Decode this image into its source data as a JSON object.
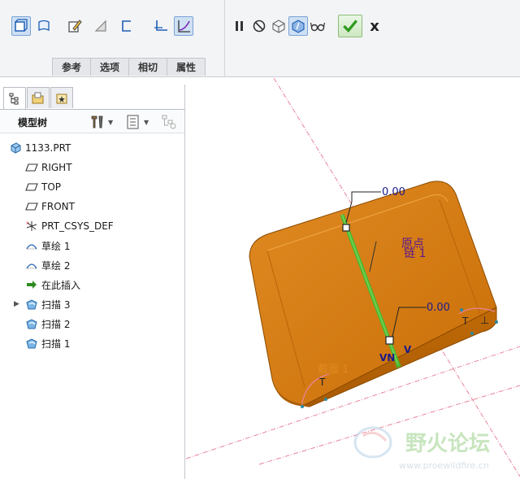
{
  "ribbon": {
    "tabs": [
      "参考",
      "选项",
      "相切",
      "属性"
    ],
    "tools_left": [
      "solid-icon",
      "surface-icon",
      "sketch-icon",
      "remove-material-icon",
      "thicken-icon",
      "constant-section-icon",
      "variable-section-icon"
    ],
    "tools_right": [
      "pause-icon",
      "no-preview-icon",
      "preview-geometry-icon",
      "verify-mode-icon",
      "glasses-icon"
    ],
    "confirm_icon": "checkmark-icon",
    "cancel_label": "x"
  },
  "model_tree": {
    "title": "模型树",
    "panel_tabs": [
      "model-tree-icon",
      "folder-browser-icon",
      "favorites-icon"
    ],
    "nodes": [
      {
        "label": "1133.PRT",
        "icon": "part-icon",
        "indent": 0,
        "expander": ""
      },
      {
        "label": "RIGHT",
        "icon": "datum-plane-icon",
        "indent": 1,
        "expander": ""
      },
      {
        "label": "TOP",
        "icon": "datum-plane-icon",
        "indent": 1,
        "expander": ""
      },
      {
        "label": "FRONT",
        "icon": "datum-plane-icon",
        "indent": 1,
        "expander": ""
      },
      {
        "label": "PRT_CSYS_DEF",
        "icon": "csys-icon",
        "indent": 1,
        "expander": ""
      },
      {
        "label": "草绘 1",
        "icon": "sketch-icon",
        "indent": 1,
        "expander": ""
      },
      {
        "label": "草绘 2",
        "icon": "sketch-icon",
        "indent": 1,
        "expander": ""
      },
      {
        "label": "在此插入",
        "icon": "insert-arrow-icon",
        "indent": 1,
        "expander": ""
      },
      {
        "label": "扫描 3",
        "icon": "sweep-icon",
        "indent": 1,
        "expander": "▶"
      },
      {
        "label": "扫描 2",
        "icon": "sweep-icon",
        "indent": 1,
        "expander": ""
      },
      {
        "label": "扫描 1",
        "icon": "sweep-icon",
        "indent": 1,
        "expander": ""
      }
    ]
  },
  "graphics": {
    "dim_top": "0.00",
    "dim_bottom": "0.00",
    "label_origin": "原点",
    "label_chain": "链 1",
    "label_section": "截面 1",
    "label_t": "T",
    "label_vn": "VN",
    "label_v": "V",
    "watermark_cn": "野火论坛",
    "watermark_url": "www.proewildfire.cn",
    "colors": {
      "body": "#d67a10",
      "body_light": "#e89a30",
      "trajectory": "#4cb830",
      "datum": "#e8849a"
    }
  }
}
